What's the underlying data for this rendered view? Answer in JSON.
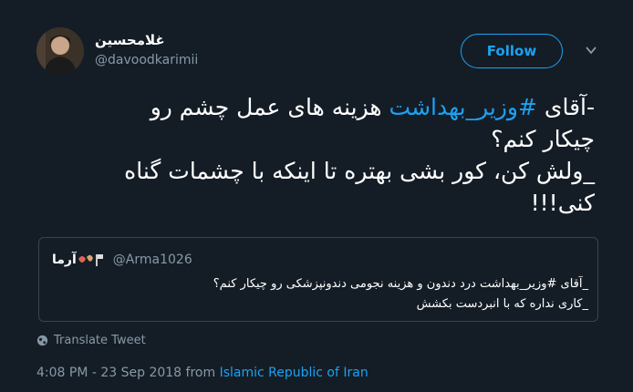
{
  "author": {
    "display_name": "غلامحسین",
    "handle": "@davoodkarimii"
  },
  "follow_label": "Follow",
  "tweet": {
    "line1_prefix": "-آقای ",
    "line1_hashtag": "#وزیر_بهداشت",
    "line1_suffix": " هزینه های عمل چشم رو",
    "line2": "چیکار کنم؟",
    "line3": "_ولش کن، کور بشی بهتره تا اینکه با چشمات گناه",
    "line4": "کنی!!!"
  },
  "quoted_tweet": {
    "display_name": "آرما",
    "handle": "@Arma1026",
    "line1": "_آقای #وزیر_بهداشت درد دندون و هزینه نجومی دندونپزشکی رو چیکار کنم؟",
    "line2": "_کاری نداره که با انبردست بکشش"
  },
  "translate_label": "Translate Tweet",
  "timestamp": "4:08 PM - 23 Sep 2018 from ",
  "location": "Islamic Republic of Iran",
  "icons": {
    "menu": "chevron-down-icon",
    "translate": "globe-icon"
  },
  "colors": {
    "background": "#141d26",
    "accent": "#1da1f2",
    "secondary_text": "#8899a6"
  }
}
